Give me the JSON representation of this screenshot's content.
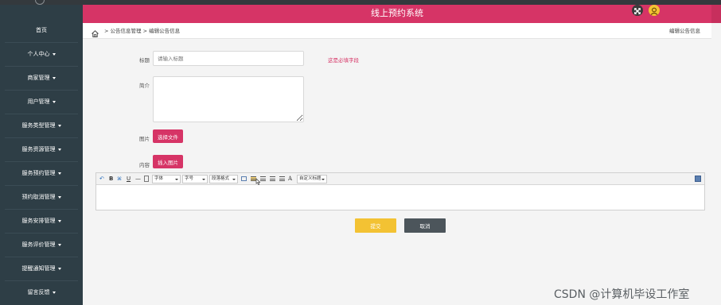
{
  "app": {
    "title": "线上预约系统",
    "logo_text": "•••••••"
  },
  "sidebar": {
    "items": [
      {
        "label": "首页",
        "caret": false
      },
      {
        "label": "个人中心",
        "caret": true
      },
      {
        "label": "商家管理",
        "caret": true
      },
      {
        "label": "用户管理",
        "caret": true
      },
      {
        "label": "服务类型管理",
        "caret": true
      },
      {
        "label": "服务资源管理",
        "caret": true
      },
      {
        "label": "服务预约管理",
        "caret": true
      },
      {
        "label": "预约取消管理",
        "caret": true
      },
      {
        "label": "服务安排管理",
        "caret": true
      },
      {
        "label": "服务评价管理",
        "caret": true
      },
      {
        "label": "提醒通知管理",
        "caret": true
      },
      {
        "label": "留言反馈",
        "caret": true
      }
    ]
  },
  "breadcrumb": {
    "path": "> 公告信息管理 > 编辑公告信息",
    "current": "编辑公告信息"
  },
  "form": {
    "title_label": "标题",
    "title_placeholder": "请输入标题",
    "required_hint": "这是必填字段",
    "intro_label": "简介",
    "intro_value": "",
    "image_label": "图片",
    "choose_file_label": "选择文件",
    "content_label": "内容",
    "insert_image_label": "插入图片"
  },
  "editor": {
    "undo": "↶",
    "bold": "B",
    "italic_icon": "⌘",
    "underline": "U",
    "strike": "—",
    "font_select": "字体",
    "size_select": "字号",
    "para_select": "段落格式",
    "font_a": "A",
    "custom_select": "自定义标题"
  },
  "actions": {
    "submit_label": "提交",
    "cancel_label": "取消"
  },
  "watermark": "CSDN @计算机毕设工作室",
  "colors": {
    "header": "#d63466",
    "sidebar": "#2e3e46",
    "submit": "#f3c233",
    "cancel": "#4c555b"
  }
}
